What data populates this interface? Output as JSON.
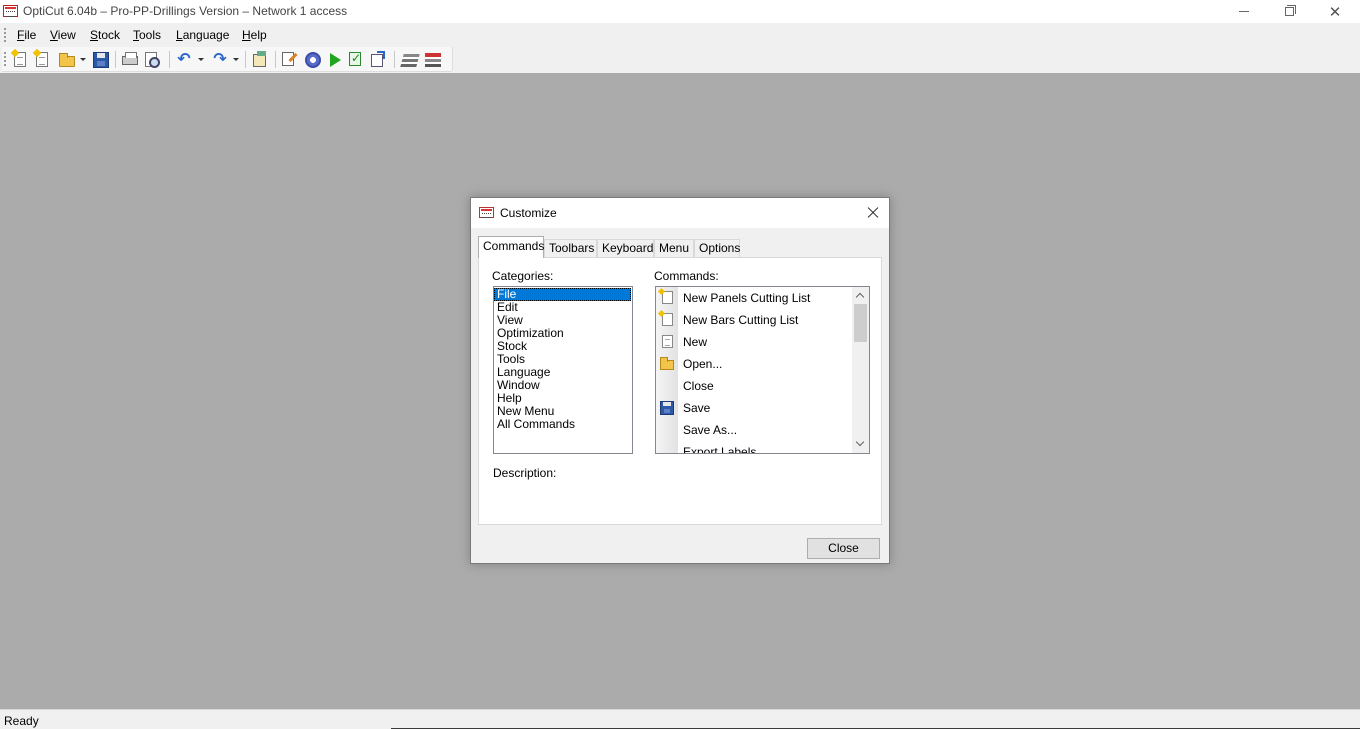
{
  "window": {
    "title": "OptiCut 6.04b – Pro-PP-Drillings Version – Network 1 access"
  },
  "menubar": {
    "items": [
      {
        "label": "File",
        "accel": "F",
        "rest": "ile"
      },
      {
        "label": "View",
        "accel": "V",
        "rest": "iew"
      },
      {
        "label": "Stock",
        "accel": "S",
        "rest": "tock"
      },
      {
        "label": "Tools",
        "accel": "T",
        "rest": "ools"
      },
      {
        "label": "Language",
        "accel": "L",
        "rest": "anguage"
      },
      {
        "label": "Help",
        "accel": "H",
        "rest": "elp"
      }
    ]
  },
  "toolbar": {
    "buttons": [
      "new-panels-list-icon",
      "new-bars-list-icon",
      "open-icon",
      "save-icon",
      "print-icon",
      "print-preview-icon",
      "undo-icon",
      "redo-icon",
      "properties-icon",
      "edit-icon",
      "settings-gear-icon",
      "run-optimization-icon",
      "check-icon",
      "export-icon",
      "layers-icon",
      "stock-icon"
    ]
  },
  "status": {
    "text": "Ready"
  },
  "dialog": {
    "title": "Customize",
    "tabs": [
      "Commands",
      "Toolbars",
      "Keyboard",
      "Menu",
      "Options"
    ],
    "active_tab": "Commands",
    "categories_label": "Categories:",
    "categories": [
      "File",
      "Edit",
      "View",
      "Optimization",
      "Stock",
      "Tools",
      "Language",
      "Window",
      "Help",
      "New Menu",
      "All Commands"
    ],
    "selected_category": "File",
    "commands_label": "Commands:",
    "commands": [
      {
        "label": "New Panels Cutting List",
        "icon": "new-panels-list-icon"
      },
      {
        "label": "New Bars Cutting List",
        "icon": "new-bars-list-icon"
      },
      {
        "label": "New",
        "icon": "new-document-icon"
      },
      {
        "label": "Open...",
        "icon": "open-folder-icon"
      },
      {
        "label": "Close",
        "icon": ""
      },
      {
        "label": "Save",
        "icon": "save-disk-icon"
      },
      {
        "label": "Save As...",
        "icon": ""
      },
      {
        "label": "Export Labels",
        "icon": ""
      }
    ],
    "description_label": "Description:",
    "close_button": "Close"
  }
}
